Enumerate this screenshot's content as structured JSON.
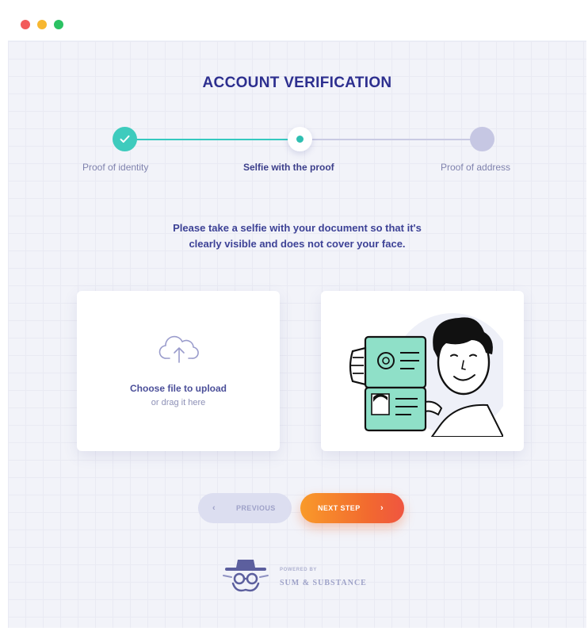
{
  "window": {
    "controls": [
      "close",
      "minimize",
      "maximize"
    ]
  },
  "page": {
    "title": "ACCOUNT VERIFICATION"
  },
  "stepper": {
    "steps": [
      {
        "label": "Proof of identity",
        "state": "done"
      },
      {
        "label": "Selfie with the proof",
        "state": "active"
      },
      {
        "label": "Proof of address",
        "state": "todo"
      }
    ]
  },
  "instruction": {
    "line1": "Please take a selfie with your document so that it's",
    "line2": "clearly visible and does not cover your face."
  },
  "upload": {
    "icon": "cloud-upload-icon",
    "title": "Choose file to upload",
    "subtitle": "or drag it here"
  },
  "illustration": {
    "icon": "selfie-with-passport-illustration"
  },
  "buttons": {
    "previous": {
      "label": "PREVIOUS",
      "icon": "chevron-left-icon",
      "chevron": "‹"
    },
    "next": {
      "label": "NEXT STEP",
      "icon": "chevron-right-icon",
      "chevron": "›"
    }
  },
  "footer": {
    "powered_by": "POWERED BY",
    "brand": "SUM & SUBSTANCE"
  },
  "colors": {
    "title": "#2d2f8f",
    "step_done": "#3ecbbd",
    "step_todo": "#c6c7e3",
    "accent_orange": "#f26a2f",
    "background": "#f2f3f9"
  }
}
